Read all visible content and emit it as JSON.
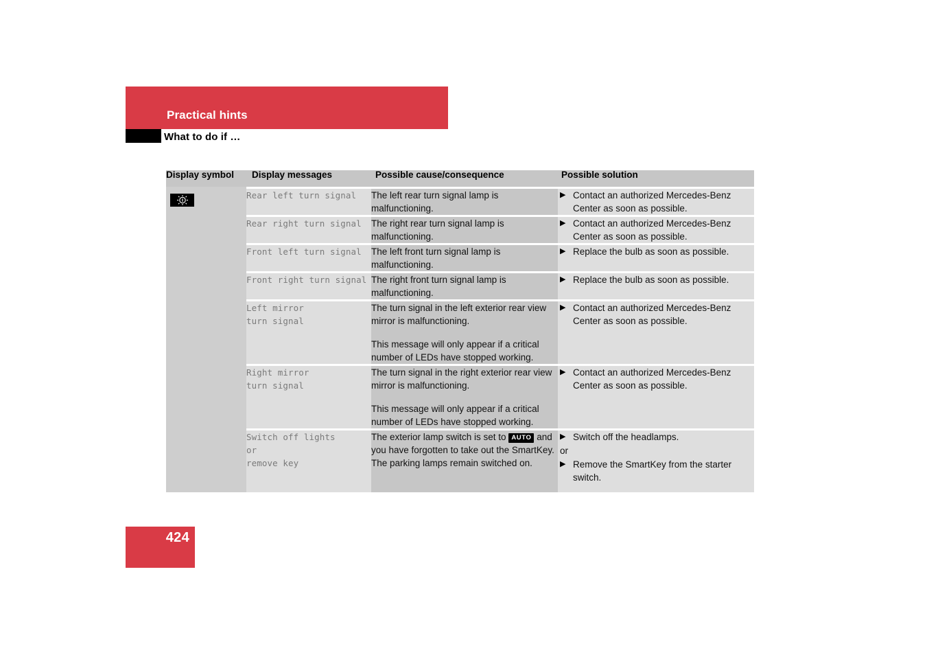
{
  "header": {
    "chapter": "Practical hints",
    "section": "What to do if …"
  },
  "table": {
    "columns": [
      "Display symbol",
      "Display messages",
      "Possible cause/consequence",
      "Possible solution"
    ],
    "symbol_icon": "lamp-failure-icon",
    "rows": [
      {
        "message": "Rear left turn signal",
        "cause": [
          "The left rear turn signal lamp is malfunctioning."
        ],
        "solutions": [
          "Contact an authorized Mercedes-Benz Center as soon as possible."
        ]
      },
      {
        "message": "Rear right turn signal",
        "cause": [
          "The right rear turn signal lamp is malfunctioning."
        ],
        "solutions": [
          "Contact an authorized Mercedes-Benz Center as soon as possible."
        ]
      },
      {
        "message": "Front left turn signal",
        "cause": [
          "The left front turn signal lamp is malfunctioning."
        ],
        "solutions": [
          "Replace the bulb as soon as possible."
        ]
      },
      {
        "message": "Front right turn signal",
        "cause": [
          "The right front turn signal lamp is malfunctioning."
        ],
        "solutions": [
          "Replace the bulb as soon as possible."
        ]
      },
      {
        "message": "Left mirror\nturn signal",
        "cause": [
          "The turn signal in the left exterior rear view mirror is malfunctioning.",
          "This message will only appear if a critical number of LEDs have stopped working."
        ],
        "solutions": [
          "Contact an authorized Mercedes-Benz Center as soon as possible."
        ]
      },
      {
        "message": "Right mirror\nturn signal",
        "cause": [
          "The turn signal in the right exterior rear view mirror is malfunctioning.",
          "This message will only appear if a critical number of LEDs have stopped working."
        ],
        "solutions": [
          "Contact an authorized Mercedes-Benz Center as soon as possible."
        ]
      },
      {
        "message": "Switch off lights\nor\nremove key",
        "cause_before_badge": "The exterior lamp switch is set to ",
        "cause_badge": "AUTO",
        "cause_after_badge": " and you have forgotten to take out the SmartKey. The parking lamps remain switched on.",
        "solutions": [
          "Switch off the headlamps.",
          "Remove the SmartKey from the starter switch."
        ],
        "solution_connector": "or"
      }
    ]
  },
  "footer": {
    "page_number": "424"
  },
  "colors": {
    "accent_red": "#d93b46",
    "header_grey": "#c6c6c6",
    "cell_light": "#dedede",
    "cell_dark": "#c6c6c6",
    "symbol_col": "#cecece"
  }
}
